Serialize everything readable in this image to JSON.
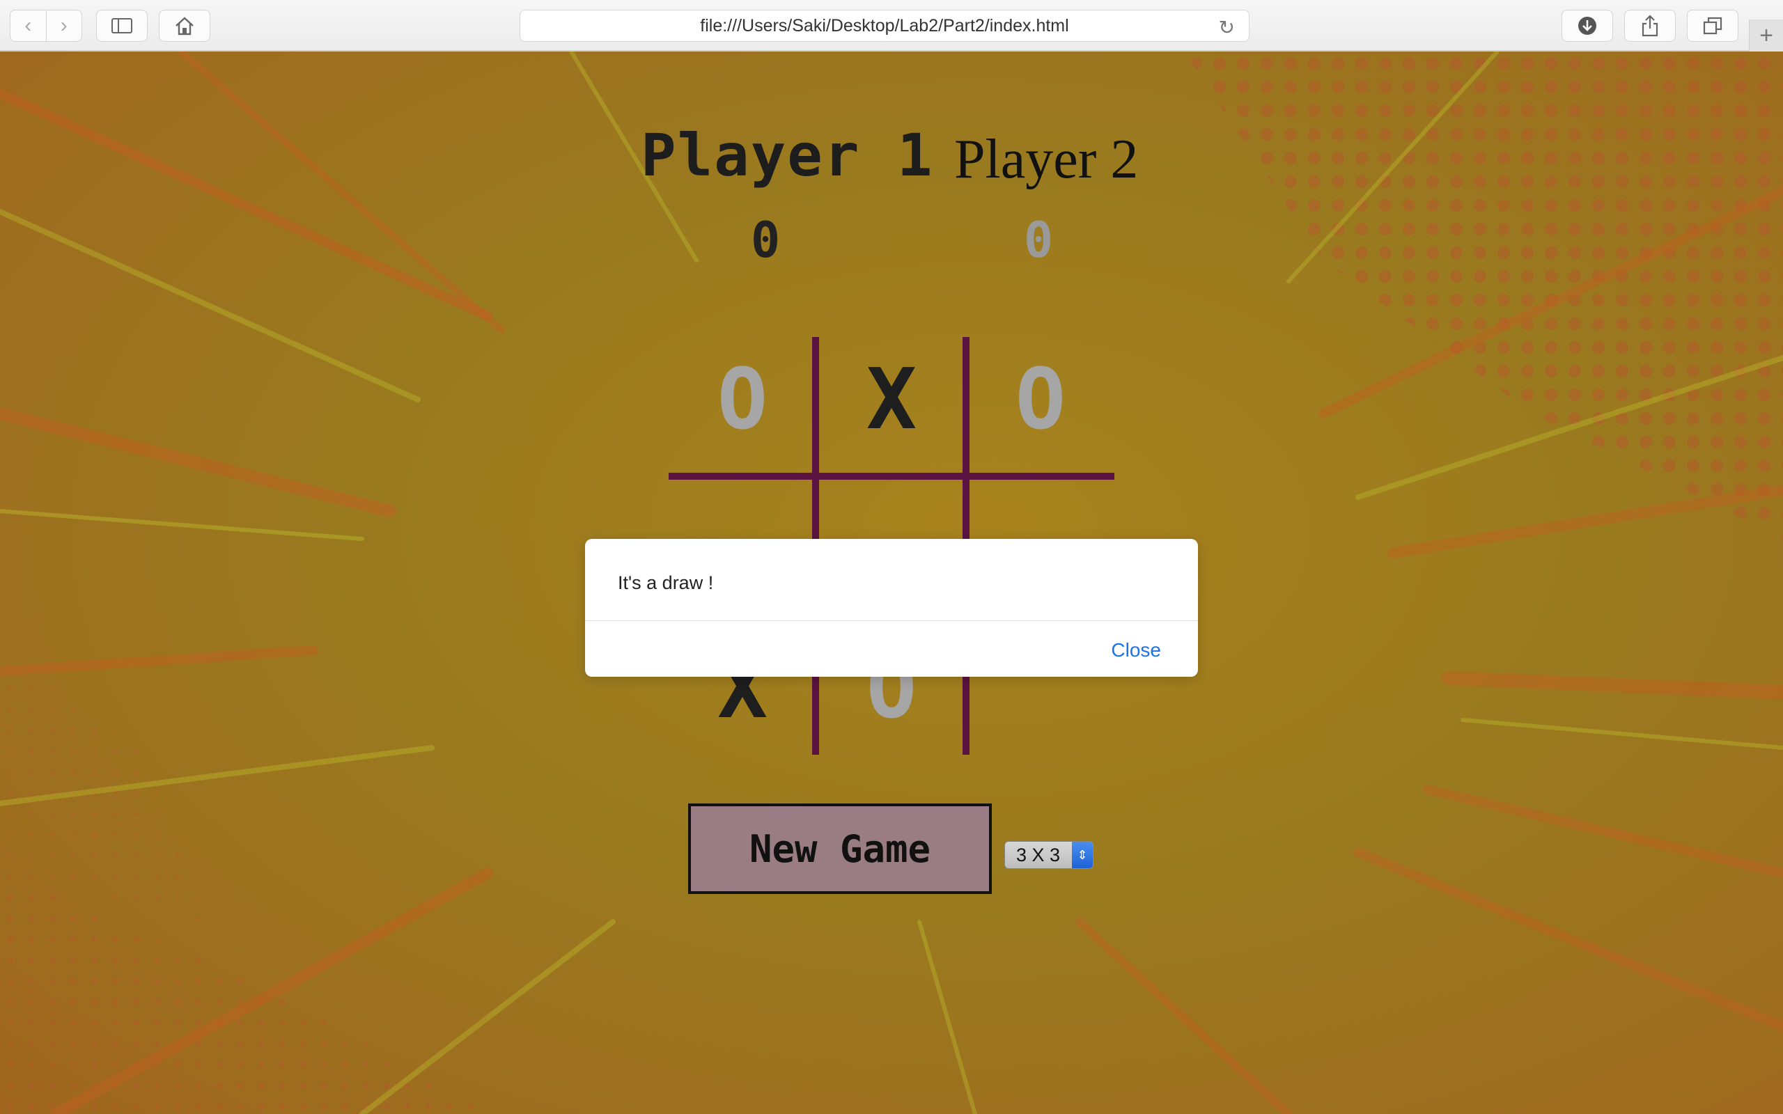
{
  "browser": {
    "url": "file:///Users/Saki/Desktop/Lab2/Part2/index.html"
  },
  "game": {
    "player1_label": "Player 1",
    "player2_label": "Player 2",
    "player1_score": "0",
    "player2_score": "0",
    "board": [
      [
        "O",
        "X",
        "O"
      ],
      [
        "",
        "",
        ""
      ],
      [
        "X",
        "O",
        ""
      ]
    ],
    "new_game_label": "New Game",
    "board_size_selected": "3 X 3"
  },
  "dialog": {
    "message": "It's a draw !",
    "close_label": "Close"
  },
  "colors": {
    "grid_line": "#5b1341",
    "x_mark": "#1e1e1e",
    "o_mark": "#a6a6a6",
    "button_bg": "#9a7c85",
    "dialog_link": "#1a73e8"
  }
}
